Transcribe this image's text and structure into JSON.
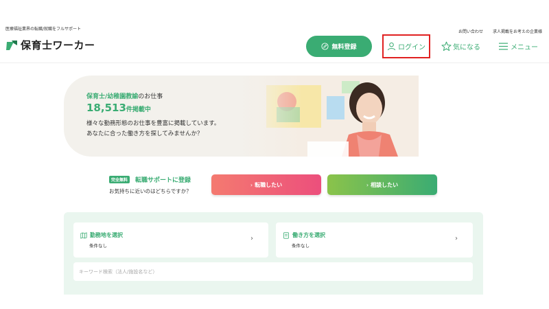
{
  "header": {
    "tagline": "医療福祉業界の転職/就職をフルサポート",
    "logo_text": "保育士ワーカー",
    "util_links": {
      "contact": "お問い合わせ",
      "corporate": "求人掲載をお考えの企業様"
    },
    "register_label": "無料登録",
    "login_label": "ログイン",
    "favorite_label": "気になる",
    "menu_label": "メニュー",
    "brand_color": "#3aac73"
  },
  "hero": {
    "title_green": "保育士/幼稚園教諭",
    "title_rest": "のお仕事",
    "count_number": "18,513",
    "count_suffix": "件掲載中",
    "desc_line1": "様々な勤務形態のお仕事を豊富に掲載しています。",
    "desc_line2": "あなたに合った働き方を探してみませんか？"
  },
  "support": {
    "badge": "完全無料",
    "title": "転職サポートに登録",
    "question": "お気持ちに近いのはどちらですか？",
    "change_label": "転職したい",
    "consult_label": "相談したい"
  },
  "search": {
    "area_label": "勤務地を選択",
    "area_value": "条件なし",
    "style_label": "働き方を選択",
    "style_value": "条件なし",
    "keyword_placeholder": "キーワード検索（法人/施設名など）"
  },
  "icons": {
    "register": "edit-icon",
    "login": "user-icon",
    "favorite": "star-icon",
    "menu": "hamburger-icon",
    "area": "map-icon",
    "style": "document-icon",
    "chevron": "chevron-right-icon"
  }
}
